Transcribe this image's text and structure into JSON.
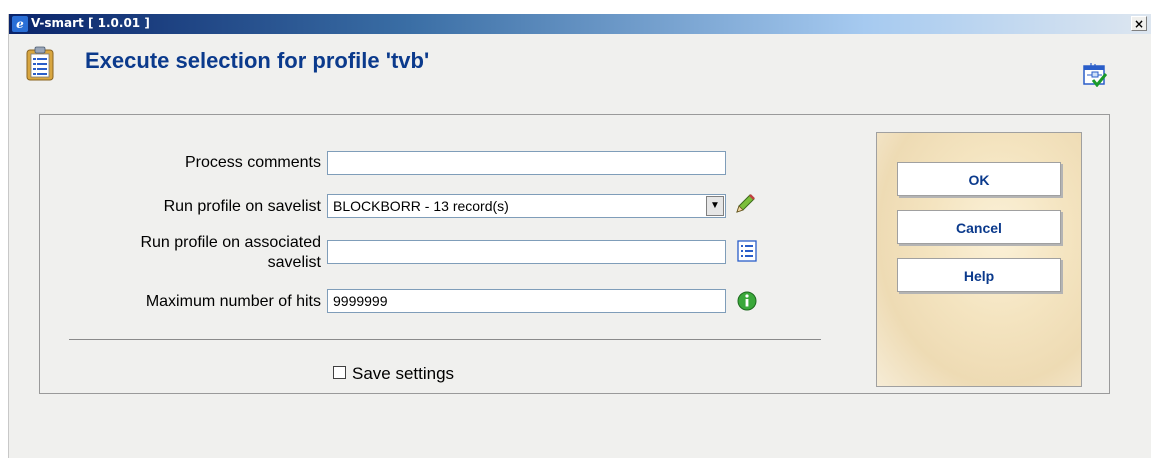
{
  "window": {
    "title": "V-smart [ 1.0.01 ]",
    "app_icon_glyph": "e",
    "close_glyph": "×"
  },
  "header": {
    "title": "Execute selection for profile 'tvb'",
    "icon": "clipboard-list-icon",
    "help_icon": "window-checkmark-icon"
  },
  "form": {
    "process_comments": {
      "label": "Process comments",
      "value": ""
    },
    "savelist": {
      "label": "Run profile on savelist",
      "value": "BLOCKBORR - 13 record(s)",
      "edit_icon": "pencil-icon"
    },
    "associated_savelist": {
      "label_line1": "Run profile on associated",
      "label_line2": "savelist",
      "value": "",
      "list_icon": "list-icon"
    },
    "max_hits": {
      "label": "Maximum number of hits",
      "value": "9999999",
      "info_icon": "info-icon"
    },
    "save_settings": {
      "label": "Save settings",
      "checked": false
    }
  },
  "buttons": {
    "ok": "OK",
    "cancel": "Cancel",
    "help": "Help"
  },
  "colors": {
    "title_blue": "#0b3a8c",
    "titlebar_dark": "#0a246a",
    "background": "#f0f0ee"
  }
}
